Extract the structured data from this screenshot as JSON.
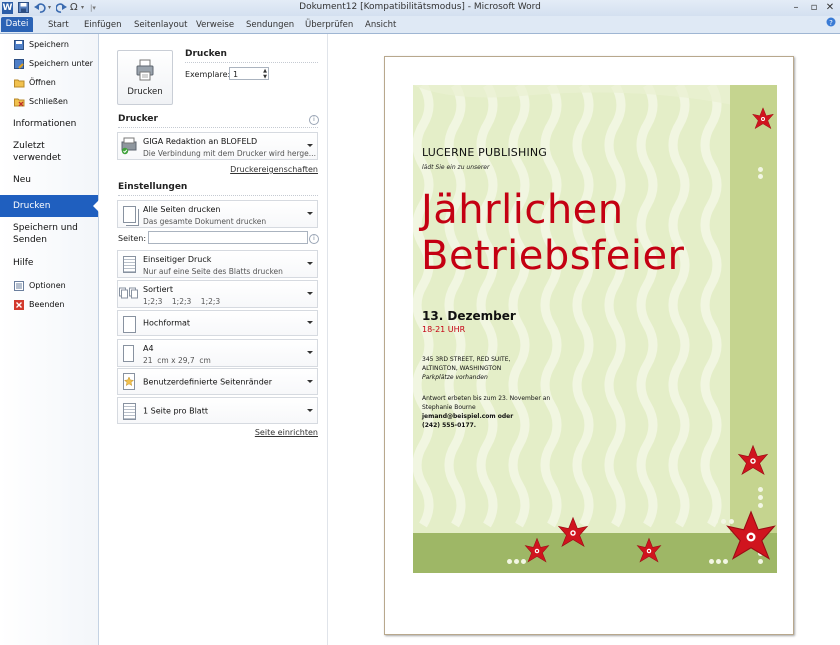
{
  "window": {
    "title": "Dokument12 [Kompatibilitätsmodus]  -  Microsoft Word",
    "app_icon": "W",
    "controls": [
      "minimize",
      "maximize",
      "close"
    ]
  },
  "quick_access": {
    "save_icon": "save-icon",
    "undo_icon": "undo-icon",
    "redo_icon": "redo-icon",
    "symbol": "Ω"
  },
  "ribbon_tabs": [
    {
      "label": "Datei",
      "active": true
    },
    {
      "label": "Start"
    },
    {
      "label": "Einfügen"
    },
    {
      "label": "Seitenlayout"
    },
    {
      "label": "Verweise"
    },
    {
      "label": "Sendungen"
    },
    {
      "label": "Überprüfen"
    },
    {
      "label": "Ansicht"
    }
  ],
  "backstage_nav": {
    "speichern": "Speichern",
    "speichern_unter": "Speichern unter",
    "oeffnen": "Öffnen",
    "schliessen": "Schließen",
    "informationen": "Informationen",
    "zuletzt_1": "Zuletzt",
    "zuletzt_2": "verwendet",
    "neu": "Neu",
    "drucken": "Drucken",
    "speichern_senden_1": "Speichern und",
    "speichern_senden_2": "Senden",
    "hilfe": "Hilfe",
    "optionen": "Optionen",
    "beenden": "Beenden"
  },
  "print_panel": {
    "print_button": "Drucken",
    "heading": "Drucken",
    "copies_label": "Exemplare:",
    "copies_value": "1",
    "printer_section": "Drucker",
    "printer_name": "GIGA Redaktion an BLOFELD",
    "printer_status": "Die Verbindung mit dem Drucker wird herge...",
    "printer_properties": "Druckereigenschaften",
    "settings_section": "Einstellungen",
    "range_title": "Alle Seiten drucken",
    "range_desc": "Das gesamte Dokument drucken",
    "pages_label": "Seiten:",
    "pages_value": "",
    "sides_title": "Einseitiger Druck",
    "sides_desc": "Nur auf eine Seite des Blatts drucken",
    "collate_title": "Sortiert",
    "collate_desc": "1;2;3    1;2;3    1;2;3",
    "orientation": "Hochformat",
    "paper_title": "A4",
    "paper_desc": "21  cm x 29,7  cm",
    "margins": "Benutzerdefinierte Seitenränder",
    "per_sheet": "1 Seite pro Blatt",
    "page_setup_link": "Seite einrichten"
  },
  "flyer": {
    "company": "LUCERNE PUBLISHING",
    "invite": "lädt Sie ein zu unserer",
    "title_line1": "Jährlichen",
    "title_line2": "Betriebsfeier",
    "date": "13. Dezember",
    "time": "18-21 UHR",
    "address_1": "345 3RD STREET, RED SUITE,",
    "address_2": "ALTINGTON, WASHINGTON",
    "parking": "Parkplätze vorhanden",
    "rsvp_1": "Antwort erbeten bis zum 23. November an",
    "rsvp_2": "Stephanie Bourne",
    "rsvp_3": "jemand@beispiel.com oder",
    "rsvp_4": "(242) 555-0177."
  },
  "colors": {
    "accent_blue": "#1f5fbf",
    "title_red": "#c40012",
    "flyer_bg": "#e4eec8",
    "flyer_band": "#c5d48f",
    "flyer_bottom": "#9eb766"
  }
}
